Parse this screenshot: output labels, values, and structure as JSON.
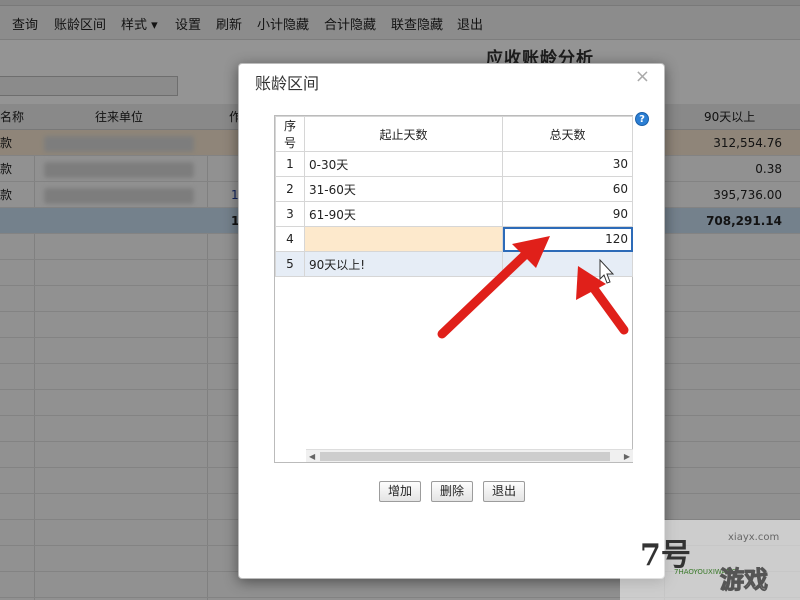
{
  "menu": [
    "查询",
    "账龄区间",
    "样式 ▾",
    "设置",
    "刷新",
    "小计隐藏",
    "合计隐藏",
    "联查隐藏",
    "退出"
  ],
  "report": {
    "title": "应收账龄分析"
  },
  "bg_table": {
    "headers": {
      "name": "名称",
      "unit": "往来单位",
      "col3": "作",
      "over90": "90天以上"
    },
    "rows": [
      {
        "name": "款",
        "col3": "",
        "over90": "312,554.76"
      },
      {
        "name": "款",
        "col3": "",
        "over90": "0.38"
      },
      {
        "name": "款",
        "col3": "1",
        "over90": "395,736.00"
      }
    ],
    "total": {
      "col3": "1",
      "over90": "708,291.14"
    }
  },
  "dialog": {
    "title": "账龄区间",
    "close": "×",
    "help": "?",
    "columns": {
      "index": "序号",
      "range": "起止天数",
      "total_days": "总天数"
    },
    "rows": [
      {
        "index": "1",
        "range": "0-30天",
        "total_days": "30"
      },
      {
        "index": "2",
        "range": "31-60天",
        "total_days": "60"
      },
      {
        "index": "3",
        "range": "61-90天",
        "total_days": "90"
      },
      {
        "index": "4",
        "range": "",
        "total_days": "120"
      },
      {
        "index": "5",
        "range": "90天以上!",
        "total_days": ""
      }
    ],
    "buttons": {
      "add": "增加",
      "delete": "删除",
      "exit": "退出"
    }
  },
  "colors": {
    "arrow": "#e0201a",
    "editing_border": "#2d6bb8",
    "highlight_row": "#fde9cc",
    "selected_row": "#e6edf6"
  },
  "watermark": {
    "logo": "7号",
    "url": "xiayx.com",
    "pinyin": "7HAOYOUXIWANG",
    "game": "游戏"
  }
}
